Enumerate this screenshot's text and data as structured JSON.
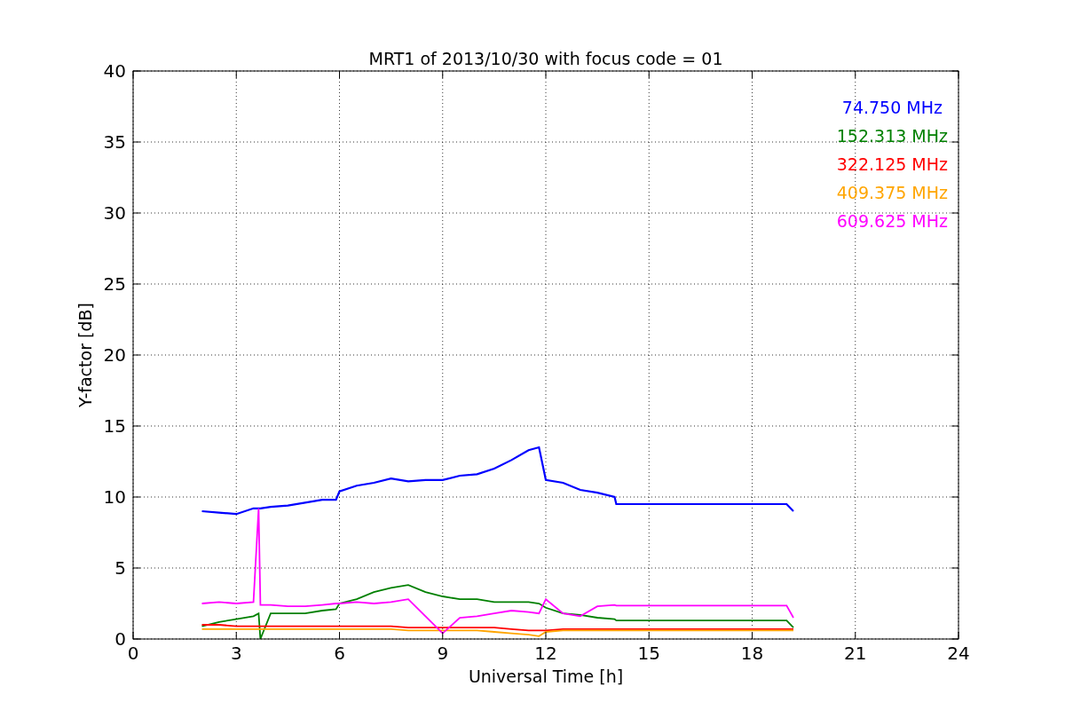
{
  "figure": {
    "chart_data": {
      "type": "line",
      "title": "MRT1 of 2013/10/30 with focus code = 01",
      "xlabel": "Universal Time [h]",
      "ylabel": "Y-factor [dB]",
      "x": [
        2,
        2.5,
        3,
        3.5,
        3.65,
        3.7,
        4,
        4.5,
        5,
        5.5,
        5.9,
        6,
        6.5,
        7,
        7.5,
        8,
        8.5,
        9,
        9.5,
        10,
        10.5,
        11,
        11.5,
        11.8,
        12,
        12.5,
        13,
        13.5,
        14,
        14.05,
        19,
        19.2
      ],
      "series": [
        {
          "name": "74.750 MHz",
          "color": "#0000ff",
          "values": [
            9,
            8.9,
            8.8,
            9.2,
            9.2,
            9.2,
            9.3,
            9.4,
            9.6,
            9.8,
            9.8,
            10.4,
            10.8,
            11,
            11.3,
            11.1,
            11.2,
            11.2,
            11.5,
            11.6,
            12,
            12.6,
            13.3,
            13.5,
            11.2,
            11,
            10.5,
            10.3,
            10,
            9.5,
            9.5,
            9
          ]
        },
        {
          "name": "152.313 MHz",
          "color": "#008000",
          "values": [
            0.9,
            1.2,
            1.4,
            1.6,
            1.8,
            0,
            1.8,
            1.8,
            1.8,
            2,
            2.1,
            2.5,
            2.8,
            3.3,
            3.6,
            3.8,
            3.3,
            3,
            2.8,
            2.8,
            2.6,
            2.6,
            2.6,
            2.5,
            2.2,
            1.8,
            1.7,
            1.5,
            1.4,
            1.3,
            1.3,
            0.8
          ]
        },
        {
          "name": "322.125 MHz",
          "color": "#ff0000",
          "values": [
            1,
            1,
            0.9,
            0.9,
            0.9,
            0.9,
            0.9,
            0.9,
            0.9,
            0.9,
            0.9,
            0.9,
            0.9,
            0.9,
            0.9,
            0.8,
            0.8,
            0.8,
            0.8,
            0.8,
            0.8,
            0.7,
            0.6,
            0.6,
            0.6,
            0.7,
            0.7,
            0.7,
            0.7,
            0.7,
            0.7,
            0.7
          ]
        },
        {
          "name": "409.375 MHz",
          "color": "#ffa500",
          "values": [
            0.7,
            0.7,
            0.7,
            0.7,
            0.7,
            0.7,
            0.7,
            0.7,
            0.7,
            0.7,
            0.7,
            0.7,
            0.7,
            0.7,
            0.7,
            0.6,
            0.6,
            0.6,
            0.6,
            0.6,
            0.5,
            0.4,
            0.3,
            0.2,
            0.5,
            0.6,
            0.6,
            0.6,
            0.6,
            0.6,
            0.6,
            0.6
          ]
        },
        {
          "name": "609.625 MHz",
          "color": "#ff00ff",
          "values": [
            2.5,
            2.6,
            2.5,
            2.6,
            9.2,
            2.4,
            2.4,
            2.3,
            2.3,
            2.4,
            2.5,
            2.5,
            2.6,
            2.5,
            2.6,
            2.8,
            1.6,
            0.4,
            1.5,
            1.6,
            1.8,
            2,
            1.9,
            1.8,
            2.8,
            1.8,
            1.6,
            2.3,
            2.4,
            2.35,
            2.35,
            1.5
          ]
        }
      ],
      "xlim": [
        0,
        24
      ],
      "ylim": [
        0,
        40
      ],
      "xticks": [
        0,
        3,
        6,
        9,
        12,
        15,
        18,
        21,
        24
      ],
      "yticks": [
        0,
        5,
        10,
        15,
        20,
        25,
        30,
        35,
        40
      ],
      "grid": true
    }
  }
}
